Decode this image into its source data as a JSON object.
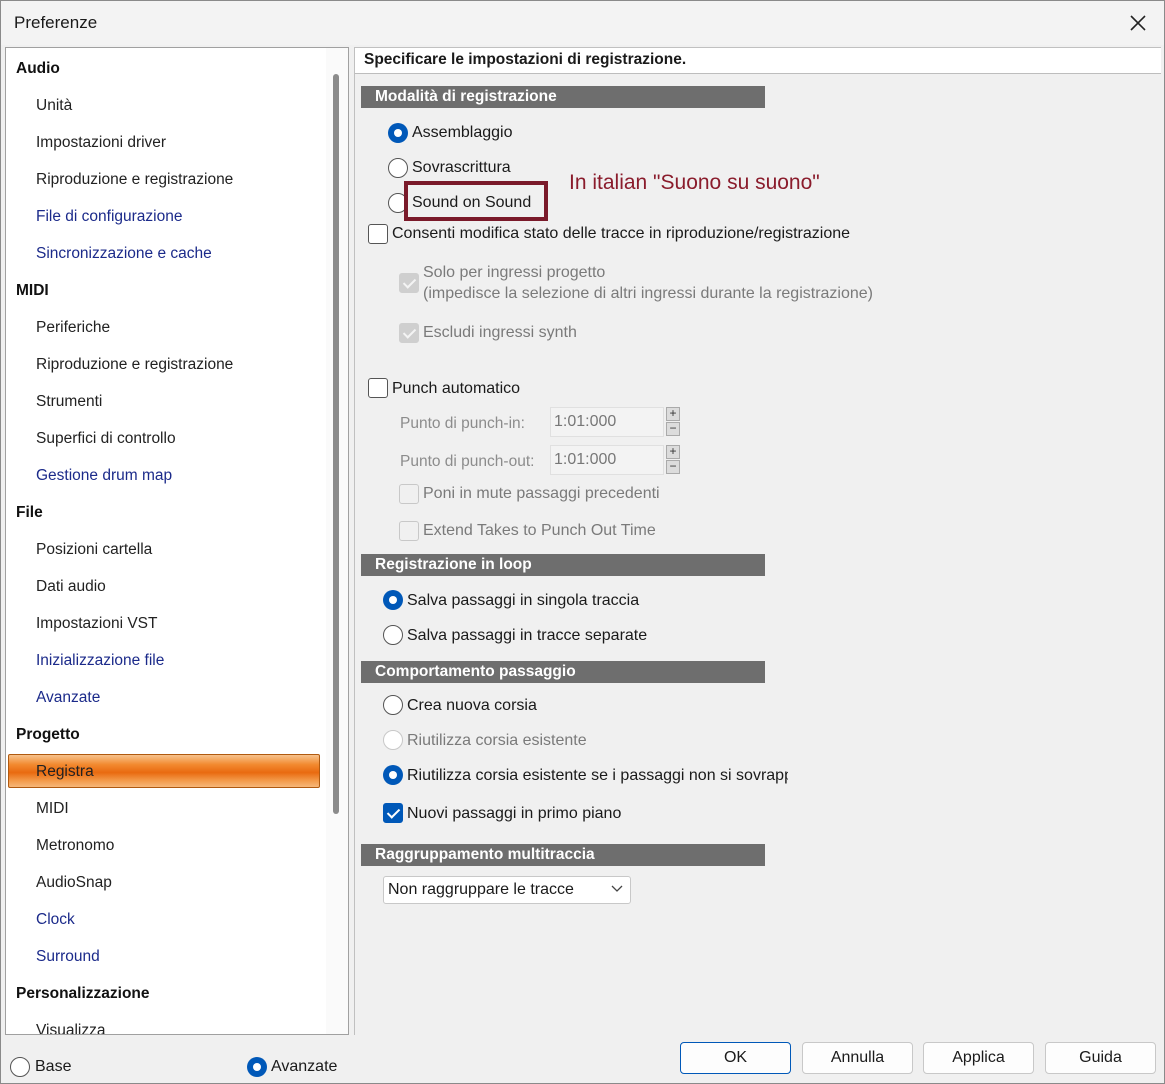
{
  "window": {
    "title": "Preferenze"
  },
  "nav": {
    "items": [
      {
        "label": "Audio",
        "type": "header"
      },
      {
        "label": "Unità",
        "type": "sub"
      },
      {
        "label": "Impostazioni driver",
        "type": "sub"
      },
      {
        "label": "Riproduzione e registrazione",
        "type": "sub"
      },
      {
        "label": "File di configurazione",
        "type": "sub-adv"
      },
      {
        "label": "Sincronizzazione e cache",
        "type": "sub-adv"
      },
      {
        "label": "MIDI",
        "type": "header"
      },
      {
        "label": "Periferiche",
        "type": "sub"
      },
      {
        "label": "Riproduzione e registrazione",
        "type": "sub"
      },
      {
        "label": "Strumenti",
        "type": "sub"
      },
      {
        "label": "Superfici di controllo",
        "type": "sub"
      },
      {
        "label": "Gestione drum map",
        "type": "sub-adv"
      },
      {
        "label": "File",
        "type": "header"
      },
      {
        "label": "Posizioni cartella",
        "type": "sub"
      },
      {
        "label": "Dati audio",
        "type": "sub"
      },
      {
        "label": "Impostazioni VST",
        "type": "sub"
      },
      {
        "label": "Inizializzazione file",
        "type": "sub-adv"
      },
      {
        "label": "Avanzate",
        "type": "sub-adv"
      },
      {
        "label": "Progetto",
        "type": "header"
      },
      {
        "label": "Registra",
        "type": "sub",
        "selected": true
      },
      {
        "label": "MIDI",
        "type": "sub"
      },
      {
        "label": "Metronomo",
        "type": "sub"
      },
      {
        "label": "AudioSnap",
        "type": "sub"
      },
      {
        "label": "Clock",
        "type": "sub-adv"
      },
      {
        "label": "Surround",
        "type": "sub-adv"
      },
      {
        "label": "Personalizzazione",
        "type": "header"
      },
      {
        "label": "Visualizza",
        "type": "sub"
      }
    ]
  },
  "content": {
    "header": "Specificare le impostazioni di registrazione.",
    "recording_mode": {
      "title": "Modalità di registrazione",
      "options": [
        "Assemblaggio",
        "Sovrascrittura",
        "Sound on Sound"
      ],
      "selected": 0
    },
    "annotation": "In italian \"Suono su suono\"",
    "allow_track_edit": "Consenti modifica stato delle tracce in riproduzione/registrazione",
    "project_inputs_only": "Solo per ingressi progetto",
    "project_inputs_note": "(impedisce la selezione di altri ingressi durante la registrazione)",
    "exclude_synth": "Escludi ingressi synth",
    "auto_punch": "Punch automatico",
    "punch_in_label": "Punto di punch-in:",
    "punch_in_value": "1:01:000",
    "punch_out_label": "Punto di punch-out:",
    "punch_out_value": "1:01:000",
    "mute_previous": "Poni in mute passaggi precedenti",
    "extend_takes": "Extend Takes to Punch Out Time",
    "loop": {
      "title": "Registrazione in loop",
      "options": [
        "Salva passaggi in singola traccia",
        "Salva passaggi in tracce separate"
      ],
      "selected": 0
    },
    "take_behavior": {
      "title": "Comportamento passaggio",
      "options": [
        "Crea nuova corsia",
        "Riutilizza corsia esistente",
        "Riutilizza corsia esistente se i passaggi non si sovrapp"
      ],
      "selected": 2
    },
    "new_takes_front": "Nuovi passaggi in primo piano",
    "multitrack": {
      "title": "Raggruppamento multitraccia",
      "dropdown_value": "Non raggruppare le tracce"
    }
  },
  "footer": {
    "mode_basic": "Base",
    "mode_advanced": "Avanzate",
    "ok": "OK",
    "cancel": "Annulla",
    "apply": "Applica",
    "help": "Guida"
  },
  "colors": {
    "accent": "#0058b8",
    "selected_nav": "#e96a10",
    "section_bar": "#6e6e6e",
    "annotation": "#8a1c2c"
  }
}
